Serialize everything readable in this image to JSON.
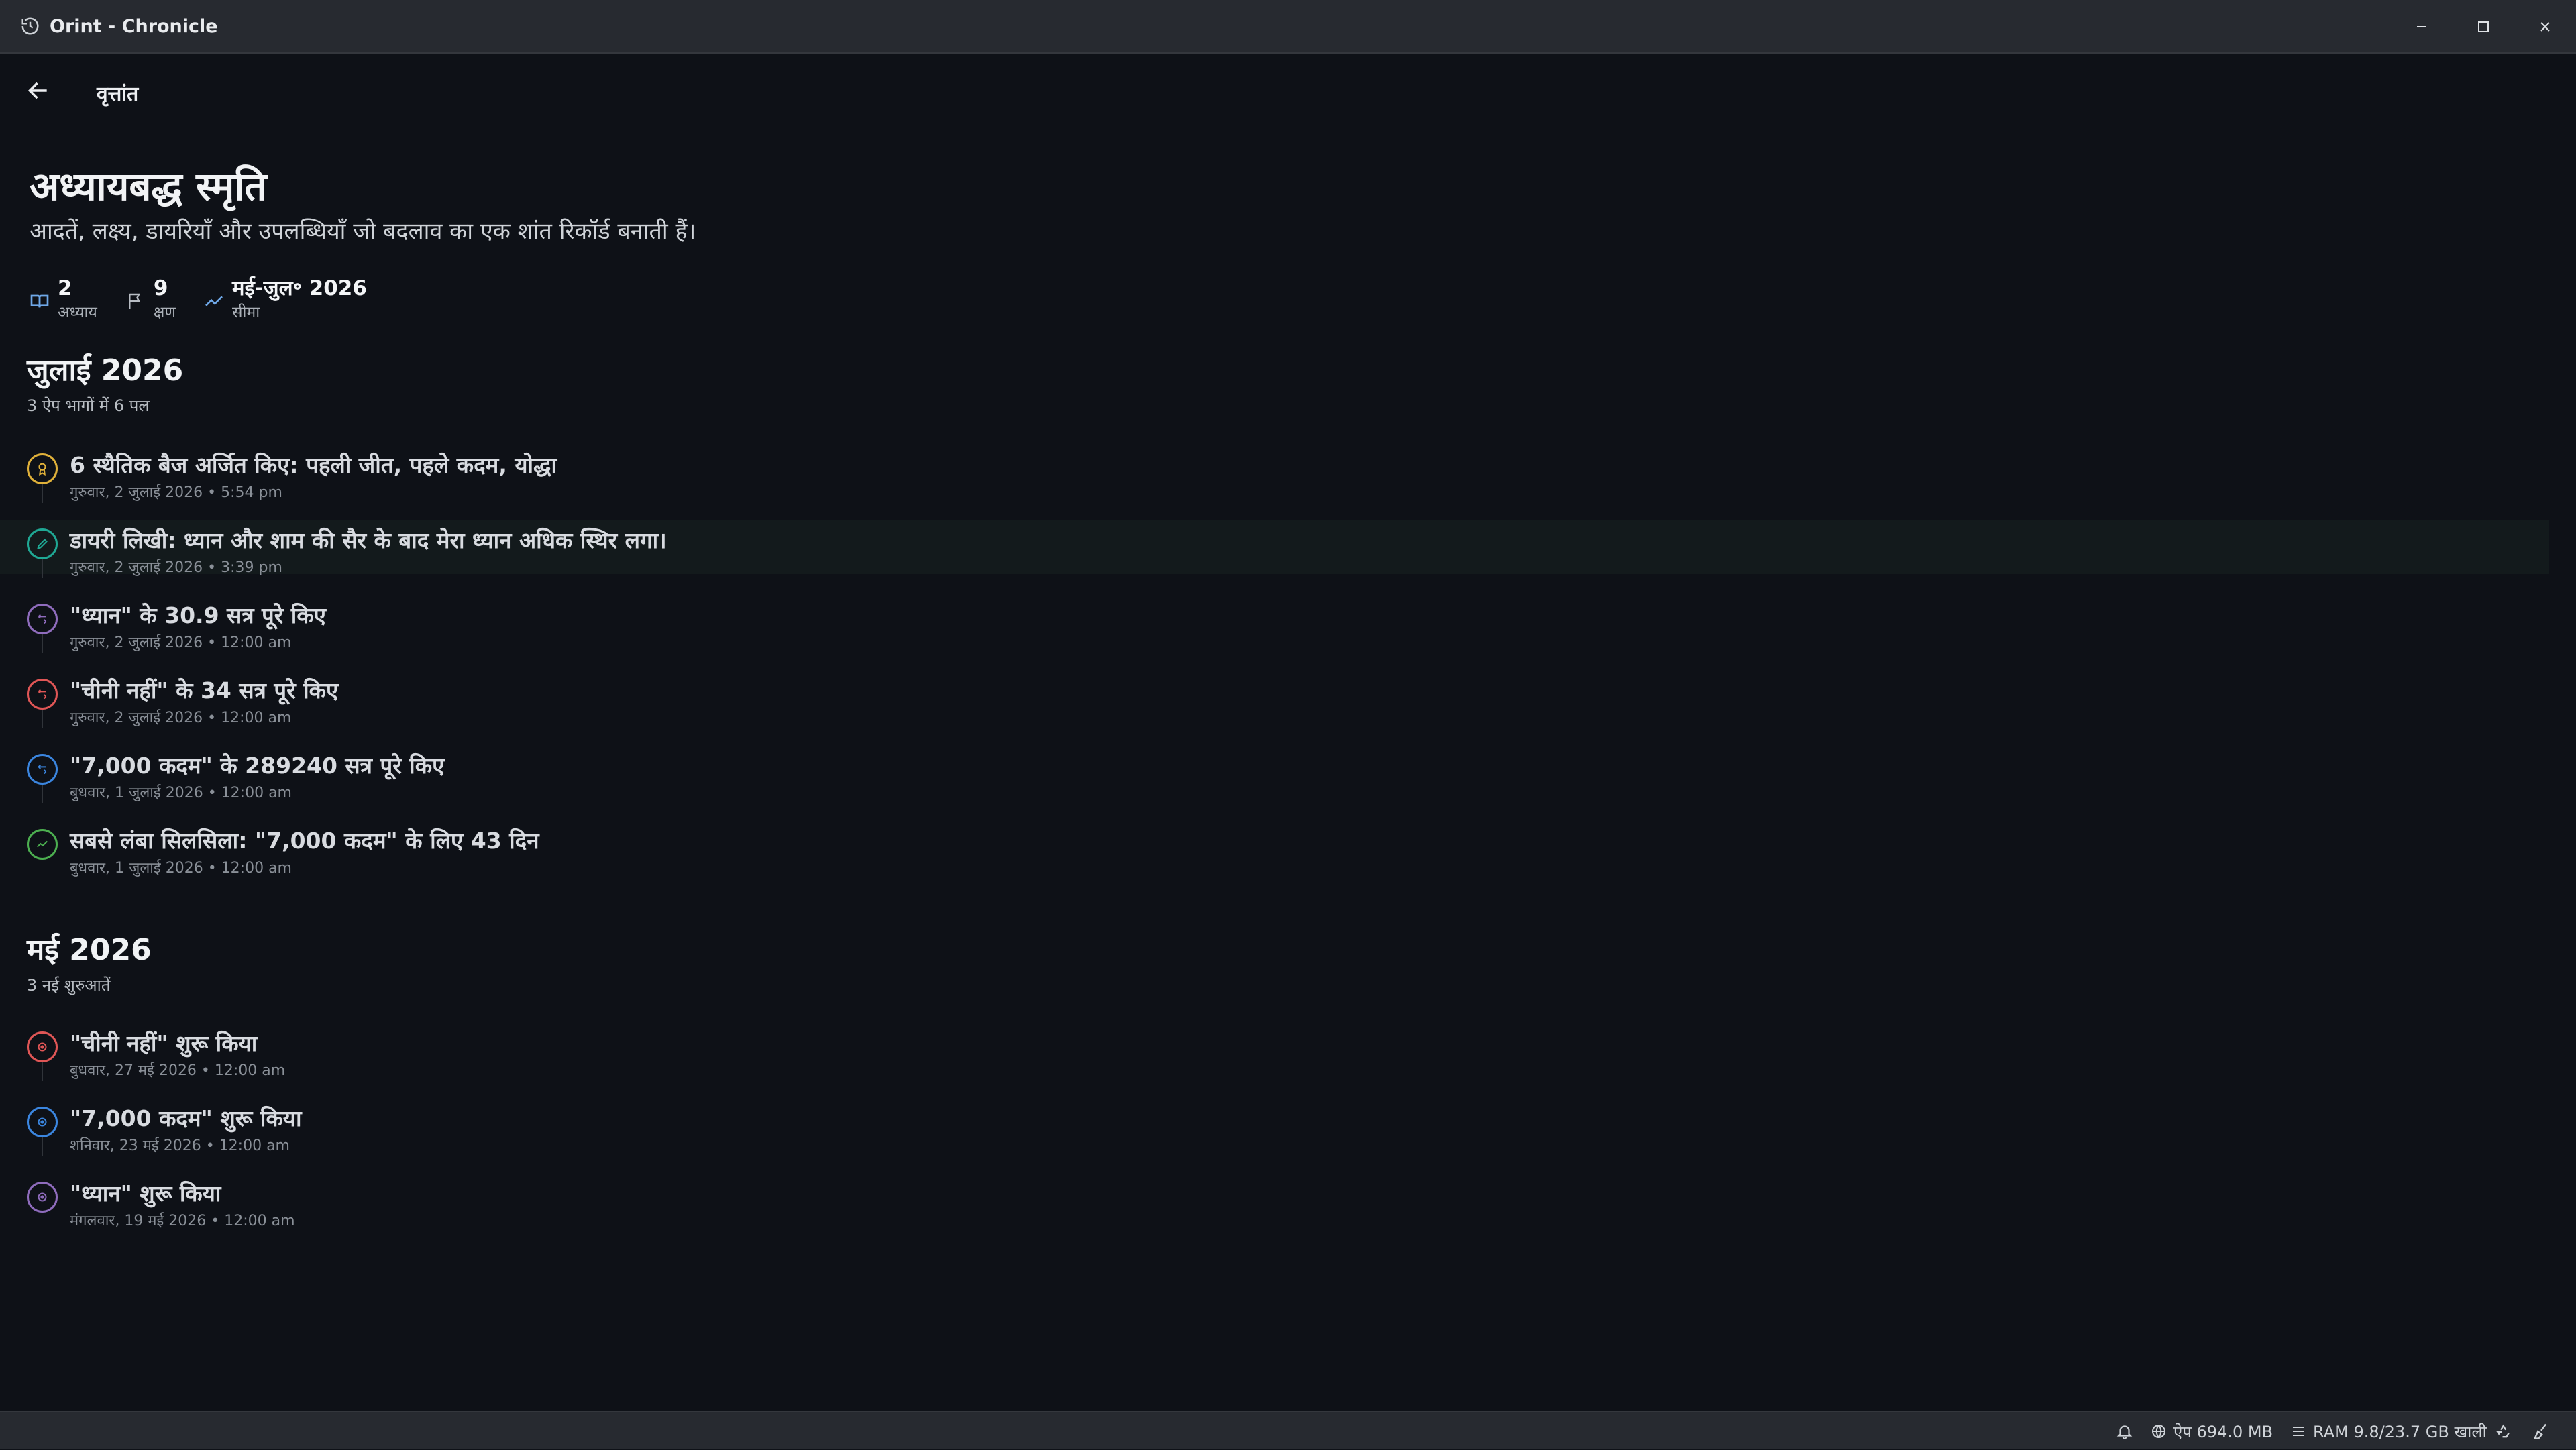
{
  "window": {
    "title": "Orint - Chronicle"
  },
  "nav": {
    "breadcrumb": "वृत्तांत"
  },
  "hero": {
    "title": "अध्यायबद्ध स्मृति",
    "subtitle": "आदतें, लक्ष्य, डायरियाँ और उपलब्धियाँ जो बदलाव का एक शांत रिकॉर्ड बनाती हैं।"
  },
  "stats": [
    {
      "value": "2",
      "label": "अध्याय",
      "icon": "book-icon"
    },
    {
      "value": "9",
      "label": "क्षण",
      "icon": "flag-icon"
    },
    {
      "value": "मई-जुल॰ 2026",
      "label": "सीमा",
      "icon": "trend-icon"
    }
  ],
  "sections": [
    {
      "month": "जुलाई 2026",
      "subtitle": "3 ऐप भागों में 6 पल",
      "events": [
        {
          "title": "6 स्थैतिक बैज अर्जित किए: पहली जीत, पहले कदम, योद्धा",
          "date": "गुरुवार, 2 जुलाई 2026 • 5:54 pm",
          "icon": "badge-icon",
          "color": "#e0b13a"
        },
        {
          "title": "डायरी लिखी: ध्यान और शाम की सैर के बाद मेरा ध्यान अधिक स्थिर लगा।",
          "date": "गुरुवार, 2 जुलाई 2026 • 3:39 pm",
          "icon": "journal-icon",
          "color": "#1fa894"
        },
        {
          "title": "\"ध्यान\" के 30.9 सत्र पूरे किए",
          "date": "गुरुवार, 2 जुलाई 2026 • 12:00 am",
          "icon": "habit-check-icon",
          "color": "#8f6cbd"
        },
        {
          "title": "\"चीनी नहीं\" के 34 सत्र पूरे किए",
          "date": "गुरुवार, 2 जुलाई 2026 • 12:00 am",
          "icon": "habit-check-icon",
          "color": "#e05656"
        },
        {
          "title": "\"7,000 कदम\" के 289240 सत्र पूरे किए",
          "date": "बुधवार, 1 जुलाई 2026 • 12:00 am",
          "icon": "habit-check-icon",
          "color": "#3b86e0"
        },
        {
          "title": "सबसे लंबा सिलसिला: \"7,000 कदम\" के लिए 43 दिन",
          "date": "बुधवार, 1 जुलाई 2026 • 12:00 am",
          "icon": "streak-icon",
          "color": "#4caf50"
        }
      ]
    },
    {
      "month": "मई 2026",
      "subtitle": "3 नई शुरुआतें",
      "events": [
        {
          "title": "\"चीनी नहीं\" शुरू किया",
          "date": "बुधवार, 27 मई 2026 • 12:00 am",
          "icon": "start-icon",
          "color": "#e05656"
        },
        {
          "title": "\"7,000 कदम\" शुरू किया",
          "date": "शनिवार, 23 मई 2026 • 12:00 am",
          "icon": "start-icon",
          "color": "#3b86e0"
        },
        {
          "title": "\"ध्यान\" शुरू किया",
          "date": "मंगलवार, 19 मई 2026 • 12:00 am",
          "icon": "start-icon",
          "color": "#8f6cbd"
        }
      ]
    }
  ],
  "statusbar": {
    "app_memory": "ऐप 694.0 MB",
    "ram": "RAM 9.8/23.7 GB खाली"
  },
  "colors": {
    "background": "#0e1117",
    "chrome": "#272a30",
    "accent_badge": "#e0b13a"
  }
}
